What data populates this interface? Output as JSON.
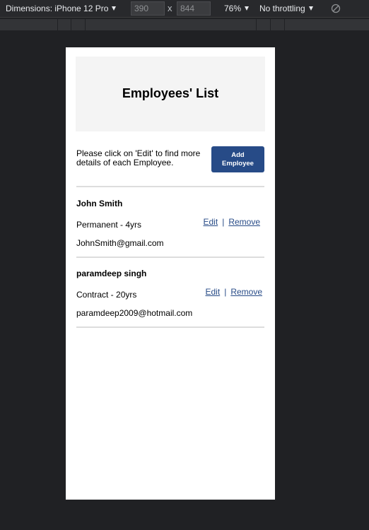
{
  "devtools": {
    "dimensions_label": "Dimensions: iPhone 12 Pro",
    "width_value": "390",
    "height_value": "844",
    "times_symbol": "x",
    "zoom_label": "76%",
    "throttling_label": "No throttling",
    "icons": {
      "dropdown": "chevron-down-icon",
      "rotate": "rotate-icon"
    }
  },
  "page": {
    "title": "Employees' List",
    "intro": "Please click on 'Edit' to find more details of each Employee.",
    "add_button": "Add Employee",
    "colors": {
      "accent": "#274b87",
      "header_bg": "#f4f4f4"
    }
  },
  "employees": [
    {
      "name": "John Smith",
      "type": "Permanent - 4yrs",
      "email": "JohnSmith@gmail.com",
      "edit_label": "Edit",
      "separator": "|",
      "remove_label": "Remove"
    },
    {
      "name": "paramdeep singh",
      "type": "Contract - 20yrs",
      "email": "paramdeep2009@hotmail.com",
      "edit_label": "Edit",
      "separator": "|",
      "remove_label": "Remove"
    }
  ]
}
